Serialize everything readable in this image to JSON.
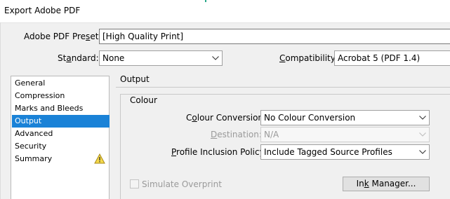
{
  "window": {
    "title": "Export Adobe PDF"
  },
  "preset": {
    "label_pre": "Adobe PDF Pre",
    "label_ul": "s",
    "label_post": "et:",
    "value": "[High Quality Print]"
  },
  "standard": {
    "label_pre": "St",
    "label_ul": "a",
    "label_post": "ndard:",
    "value": "None"
  },
  "compatibility": {
    "label_pre": "",
    "label_ul": "C",
    "label_post": "ompatibility:",
    "value": "Acrobat 5 (PDF 1.4)"
  },
  "sidebar": {
    "items": [
      {
        "label": "General",
        "selected": false
      },
      {
        "label": "Compression",
        "selected": false
      },
      {
        "label": "Marks and Bleeds",
        "selected": false
      },
      {
        "label": "Output",
        "selected": true
      },
      {
        "label": "Advanced",
        "selected": false
      },
      {
        "label": "Security",
        "selected": false
      },
      {
        "label": "Summary",
        "selected": false,
        "icon": "warning-icon"
      }
    ],
    "selected_color": "#1a82d7"
  },
  "output": {
    "section_title": "Output",
    "colour_group": {
      "title": "Colour",
      "conversion": {
        "label_pre": "C",
        "label_ul": "o",
        "label_post": "lour Conversion:",
        "value": "No Colour Conversion"
      },
      "destination": {
        "label_pre": "",
        "label_ul": "D",
        "label_post": "estination:",
        "value": "N/A",
        "disabled": true
      },
      "policy": {
        "label_pre": "",
        "label_ul": "P",
        "label_post": "rofile Inclusion Policy:",
        "value": "Include Tagged Source Profiles"
      }
    },
    "simulate_overprint": {
      "label": "Simulate Overprint",
      "checked": false,
      "disabled": true
    },
    "ink_manager": {
      "label_pre": "In",
      "label_ul": "k",
      "label_post": " Manager..."
    }
  }
}
